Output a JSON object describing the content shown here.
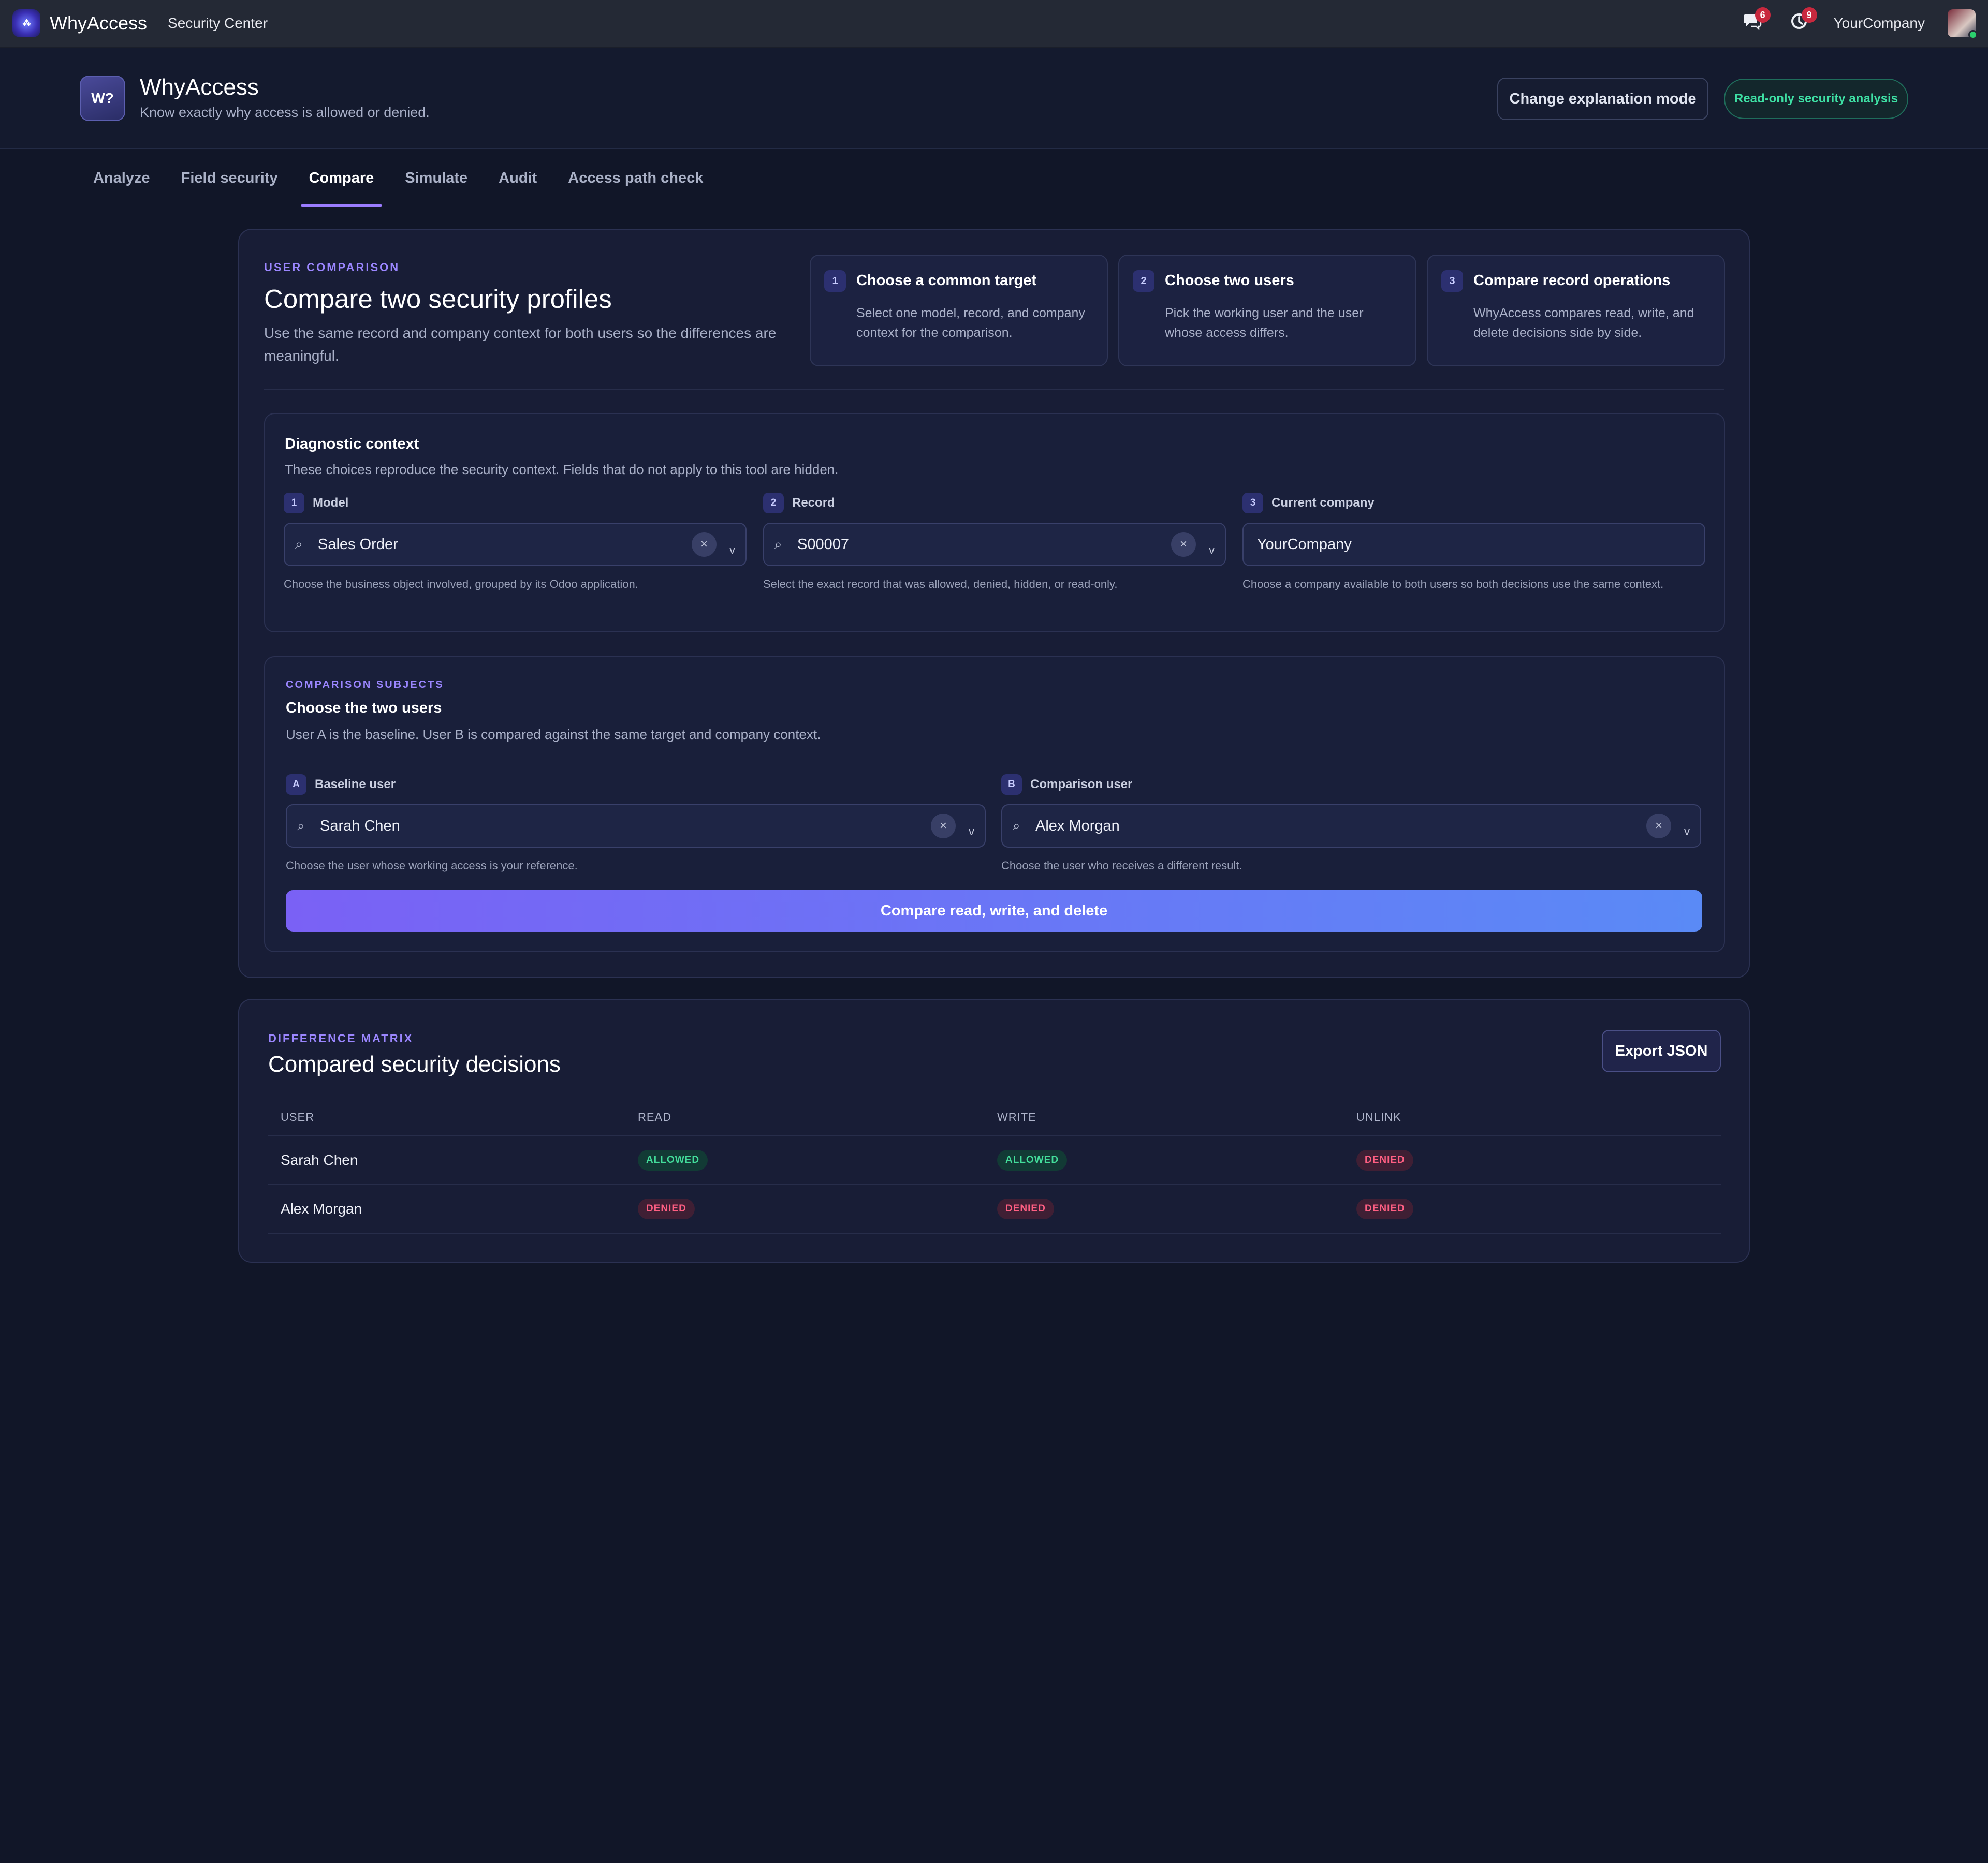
{
  "navbar": {
    "app_name": "WhyAccess",
    "section": "Security Center",
    "messages_count": "6",
    "activities_count": "9",
    "company": "YourCompany"
  },
  "header": {
    "logo_text": "W?",
    "title": "WhyAccess",
    "subtitle": "Know exactly why access is allowed or denied.",
    "explain_button": "Change explanation mode",
    "readonly_badge": "Read-only security analysis"
  },
  "tabs": [
    {
      "label": "Analyze"
    },
    {
      "label": "Field security"
    },
    {
      "label": "Compare",
      "active": true
    },
    {
      "label": "Simulate"
    },
    {
      "label": "Audit"
    },
    {
      "label": "Access path check"
    }
  ],
  "comparison": {
    "kicker": "USER COMPARISON",
    "title": "Compare two security profiles",
    "description": "Use the same record and company context for both users so the differences are meaningful.",
    "steps": [
      {
        "num": "1",
        "title": "Choose a common target",
        "desc": "Select one model, record, and company context for the comparison."
      },
      {
        "num": "2",
        "title": "Choose two users",
        "desc": "Pick the working user and the user whose access differs."
      },
      {
        "num": "3",
        "title": "Compare record operations",
        "desc": "WhyAccess compares read, write, and delete decisions side by side."
      }
    ]
  },
  "diagnostic": {
    "title": "Diagnostic context",
    "description": "These choices reproduce the security context. Fields that do not apply to this tool are hidden.",
    "fields": [
      {
        "num": "1",
        "label": "Model",
        "value": "Sales Order",
        "help": "Choose the business object involved, grouped by its Odoo application."
      },
      {
        "num": "2",
        "label": "Record",
        "value": "S00007",
        "help": "Select the exact record that was allowed, denied, hidden, or read-only."
      },
      {
        "num": "3",
        "label": "Current company",
        "value": "YourCompany",
        "help": "Choose a company available to both users so both decisions use the same context."
      }
    ]
  },
  "subjects": {
    "kicker": "COMPARISON SUBJECTS",
    "title": "Choose the two users",
    "description": "User A is the baseline. User B is compared against the same target and company context.",
    "baseline": {
      "tag": "A",
      "label": "Baseline user",
      "value": "Sarah Chen",
      "help": "Choose the user whose working access is your reference."
    },
    "comparison": {
      "tag": "B",
      "label": "Comparison user",
      "value": "Alex Morgan",
      "help": "Choose the user who receives a different result."
    },
    "compare_button": "Compare read, write, and delete"
  },
  "matrix": {
    "kicker": "DIFFERENCE MATRIX",
    "title": "Compared security decisions",
    "export_button": "Export JSON",
    "columns": [
      "USER",
      "READ",
      "WRITE",
      "UNLINK"
    ],
    "rows": [
      {
        "user": "Sarah Chen",
        "read": "ALLOWED",
        "write": "ALLOWED",
        "unlink": "DENIED"
      },
      {
        "user": "Alex Morgan",
        "read": "DENIED",
        "write": "DENIED",
        "unlink": "DENIED"
      }
    ]
  },
  "colors": {
    "background": "#111628",
    "accent": "#9b7cff",
    "allowed": "#43dd9b",
    "denied": "#ff5f83"
  },
  "icons": {
    "search": "search-icon",
    "clear": "clear-icon",
    "chevron": "chevron-down-icon",
    "messages": "chat-icon",
    "activities": "clock-icon"
  }
}
